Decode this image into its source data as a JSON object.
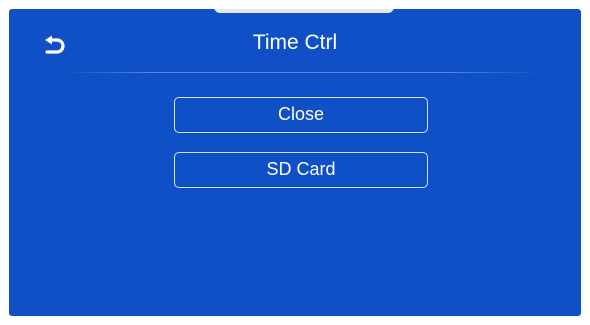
{
  "header": {
    "title": "Time Ctrl"
  },
  "icons": {
    "back": "back-arrow-icon"
  },
  "menu": {
    "items": [
      {
        "label": "Close"
      },
      {
        "label": "SD Card"
      }
    ]
  },
  "colors": {
    "background": "#0f50c6",
    "text": "#ffffff",
    "button_border": "#d8e2f6"
  }
}
